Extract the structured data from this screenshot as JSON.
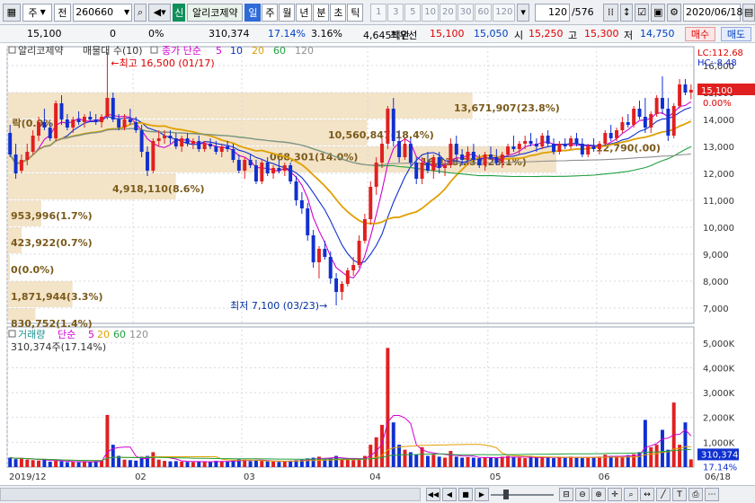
{
  "toolbar": {
    "market_type": "주",
    "market_scope": "전",
    "stock_code": "260660",
    "badge": "신",
    "stock_name": "알리코제약",
    "periods": [
      "일",
      "주",
      "월",
      "년",
      "분",
      "초",
      "틱"
    ],
    "selected_period": "일",
    "minute_units": [
      "1",
      "3",
      "5",
      "10",
      "20",
      "30",
      "60",
      "120"
    ],
    "count_display": "120",
    "count_total": "/576",
    "date": "2020/06/18"
  },
  "quote": {
    "price": "15,100",
    "change": "0",
    "change_pct": "0%",
    "volume": "310,374",
    "volume_ratio": "17.14%",
    "turnover": "3.16%",
    "amount": "4,645백만",
    "best_label": "최우선",
    "best_ask": "15,100",
    "best_bid": "15,050",
    "open_label": "시",
    "open": "15,250",
    "high_label": "고",
    "high": "15,300",
    "low_label": "저",
    "low": "14,750",
    "buy_label": "매수",
    "sell_label": "매도"
  },
  "legend": {
    "stock_name": "알리코제약",
    "profile_label": "매물대 수(10)",
    "ma_label": "종가 단순",
    "ma_periods": [
      "5",
      "10",
      "20",
      "60",
      "120"
    ],
    "ma_colors": [
      "#d000d0",
      "#1030d0",
      "#e0a000",
      "#20a040",
      "#909090"
    ],
    "lc": "LC:112.68",
    "hc": "HC:-8.48",
    "volume_label": "거래량",
    "volume_ma_label": "단순",
    "volume_info": "310,374주(17.14%)"
  },
  "colors": {
    "up": "#e02020",
    "down": "#1030d0",
    "profile": "#f3e3c7",
    "price_tag": "#e02020"
  },
  "chart_data": {
    "type": "candlestick",
    "price_axis": {
      "min": 6500,
      "max": 16500,
      "ticks": [
        7000,
        8000,
        9000,
        10000,
        11000,
        12000,
        13000,
        14000,
        15000,
        16000
      ],
      "labels": [
        "7,000",
        "8,000",
        "9,000",
        "10,000",
        "11,000",
        "12,000",
        "13,000",
        "14,000",
        "15,000",
        "16,000"
      ]
    },
    "current_price_label": "15,100",
    "current_price_pct": "0.00%",
    "volume_axis": {
      "max": 5500000,
      "ticks": [
        1000000,
        2000000,
        3000000,
        4000000,
        5000000
      ],
      "labels": [
        "1,000K",
        "2,000K",
        "3,000K",
        "4,000K",
        "5,000K"
      ]
    },
    "current_volume_label": "310,374",
    "current_volume_pct": "17.14%",
    "x_labels": [
      {
        "i": 0,
        "t": "2019/12"
      },
      {
        "i": 22,
        "t": "02"
      },
      {
        "i": 41,
        "t": "03"
      },
      {
        "i": 63,
        "t": "04"
      },
      {
        "i": 84,
        "t": "05"
      },
      {
        "i": 103,
        "t": "06"
      }
    ],
    "x_last_label": "06/18",
    "n_days": 120,
    "max_note": "최고 16,500 (01/17)",
    "min_note": "최저 7,100 (03/23)",
    "profile": [
      {
        "lo": 14000,
        "hi": 15000,
        "label": "13,671,907(23.8%)"
      },
      {
        "lo": 13000,
        "hi": 14000,
        "label": "10,560,847(18.4%)"
      },
      {
        "lo": 12000,
        "hi": 13000,
        "label": "16,138,232(28.1%)"
      },
      {
        "lo": 11000,
        "hi": 12000,
        "label": "4,918,110(8.6%)"
      },
      {
        "lo": 10000,
        "hi": 11000,
        "label": "953,996(1.7%)"
      },
      {
        "lo": 9000,
        "hi": 10000,
        "label": "423,922(0.7%)"
      },
      {
        "lo": 8000,
        "hi": 9000,
        "label": "0(0.0%)"
      },
      {
        "lo": 7000,
        "hi": 8000,
        "label": "1,871,944(3.3%)"
      },
      {
        "lo": 6000,
        "hi": 7000,
        "label": "830,752(1.4%)"
      }
    ],
    "extra_labels": [
      {
        "i": 1,
        "p": 13900,
        "t": "락(0.0%)"
      },
      {
        "i": 46,
        "p": 12650,
        "t": "068,301(14.0%)"
      },
      {
        "i": 103,
        "p": 12990,
        "t": "12,790(.00)"
      }
    ],
    "ohlc": [
      [
        13500,
        13800,
        12600,
        12700
      ],
      [
        12700,
        13100,
        11800,
        12000
      ],
      [
        12100,
        12700,
        12000,
        12500
      ],
      [
        12500,
        13100,
        12300,
        12800
      ],
      [
        12800,
        13600,
        12700,
        13400
      ],
      [
        13400,
        14100,
        13200,
        13900
      ],
      [
        13900,
        14400,
        13600,
        13700
      ],
      [
        13700,
        13900,
        13200,
        13300
      ],
      [
        13300,
        14700,
        13200,
        14600
      ],
      [
        14600,
        14900,
        13800,
        14000
      ],
      [
        14000,
        14200,
        13600,
        13700
      ],
      [
        13700,
        14100,
        13500,
        14000
      ],
      [
        14000,
        14300,
        13800,
        13900
      ],
      [
        13900,
        14200,
        13700,
        14100
      ],
      [
        14100,
        14300,
        13900,
        14000
      ],
      [
        14000,
        14200,
        13800,
        13900
      ],
      [
        13900,
        14200,
        13700,
        14100
      ],
      [
        14100,
        16500,
        14000,
        14800
      ],
      [
        14800,
        15000,
        13900,
        14000
      ],
      [
        14000,
        14200,
        13600,
        13700
      ],
      [
        13700,
        14200,
        13600,
        14000
      ],
      [
        14000,
        14400,
        13800,
        13900
      ],
      [
        13900,
        14100,
        13500,
        13600
      ],
      [
        13600,
        13800,
        12600,
        12800
      ],
      [
        12800,
        13000,
        11900,
        12100
      ],
      [
        12100,
        13300,
        12000,
        13200
      ],
      [
        13200,
        13600,
        13000,
        13300
      ],
      [
        13300,
        13600,
        13100,
        13400
      ],
      [
        13400,
        13600,
        13100,
        13300
      ],
      [
        13300,
        13500,
        12900,
        13000
      ],
      [
        13000,
        13400,
        12800,
        13300
      ],
      [
        13300,
        13500,
        13000,
        13100
      ],
      [
        13100,
        13300,
        12900,
        13200
      ],
      [
        13200,
        13400,
        12800,
        12900
      ],
      [
        12900,
        13200,
        12800,
        13100
      ],
      [
        13100,
        13300,
        12900,
        13000
      ],
      [
        13000,
        13200,
        12700,
        12800
      ],
      [
        12800,
        13100,
        12600,
        13000
      ],
      [
        13000,
        13200,
        12800,
        12900
      ],
      [
        12900,
        13100,
        12400,
        12500
      ],
      [
        12500,
        12700,
        12000,
        12100
      ],
      [
        12100,
        12600,
        11800,
        12500
      ],
      [
        12500,
        12700,
        12200,
        12300
      ],
      [
        12300,
        12500,
        11600,
        11700
      ],
      [
        11700,
        12500,
        11600,
        12400
      ],
      [
        12400,
        12600,
        11900,
        12000
      ],
      [
        12000,
        12300,
        11800,
        12200
      ],
      [
        12200,
        12500,
        12000,
        12100
      ],
      [
        12100,
        12400,
        11900,
        12300
      ],
      [
        12300,
        12400,
        11600,
        11700
      ],
      [
        11700,
        11900,
        10800,
        11000
      ],
      [
        11000,
        11300,
        10500,
        10700
      ],
      [
        10700,
        10900,
        9500,
        9700
      ],
      [
        9700,
        9900,
        8500,
        8700
      ],
      [
        8700,
        9300,
        8100,
        9200
      ],
      [
        9200,
        9500,
        8800,
        8900
      ],
      [
        8900,
        9100,
        7900,
        8100
      ],
      [
        8100,
        8300,
        7100,
        7600
      ],
      [
        7600,
        8000,
        7300,
        7900
      ],
      [
        7900,
        8500,
        7800,
        8400
      ],
      [
        8400,
        8900,
        8200,
        8600
      ],
      [
        8600,
        9700,
        8500,
        9500
      ],
      [
        9500,
        10500,
        9400,
        10300
      ],
      [
        10300,
        11700,
        10100,
        11500
      ],
      [
        11500,
        12600,
        11200,
        12400
      ],
      [
        12400,
        13300,
        12200,
        13100
      ],
      [
        13100,
        14500,
        12900,
        14400
      ],
      [
        14400,
        14800,
        13000,
        13200
      ],
      [
        13200,
        13600,
        12400,
        12600
      ],
      [
        12600,
        13300,
        12500,
        13100
      ],
      [
        13100,
        13300,
        12300,
        12400
      ],
      [
        12400,
        12600,
        11600,
        11800
      ],
      [
        11800,
        12600,
        11600,
        12400
      ],
      [
        12400,
        12800,
        12000,
        12100
      ],
      [
        12100,
        12700,
        11800,
        12600
      ],
      [
        12600,
        12800,
        12000,
        12200
      ],
      [
        12200,
        12500,
        11900,
        12300
      ],
      [
        12300,
        13300,
        12200,
        13100
      ],
      [
        13100,
        13400,
        12600,
        12700
      ],
      [
        12700,
        12900,
        12300,
        12500
      ],
      [
        12500,
        13000,
        12300,
        12800
      ],
      [
        12800,
        13100,
        12400,
        12500
      ],
      [
        12500,
        12700,
        12200,
        12300
      ],
      [
        12300,
        12800,
        12100,
        12700
      ],
      [
        12700,
        13000,
        12500,
        12600
      ],
      [
        12600,
        12900,
        12300,
        12400
      ],
      [
        12400,
        12800,
        12200,
        12700
      ],
      [
        12700,
        13100,
        12600,
        13000
      ],
      [
        13000,
        13400,
        12800,
        12900
      ],
      [
        12900,
        13200,
        12700,
        13100
      ],
      [
        13100,
        13400,
        12900,
        13200
      ],
      [
        13200,
        13500,
        13000,
        13100
      ],
      [
        13100,
        13300,
        12800,
        13000
      ],
      [
        13000,
        13500,
        12900,
        13400
      ],
      [
        13400,
        13600,
        13000,
        13100
      ],
      [
        13100,
        13300,
        12700,
        12800
      ],
      [
        12800,
        13200,
        12700,
        13100
      ],
      [
        13100,
        13300,
        12900,
        13000
      ],
      [
        13000,
        13400,
        12900,
        13300
      ],
      [
        13300,
        13500,
        13000,
        13100
      ],
      [
        13100,
        13300,
        12600,
        12700
      ],
      [
        12700,
        13100,
        12600,
        13000
      ],
      [
        13000,
        13300,
        12800,
        12900
      ],
      [
        12900,
        13200,
        12700,
        13100
      ],
      [
        13100,
        13600,
        13000,
        13500
      ],
      [
        13500,
        13800,
        13200,
        13300
      ],
      [
        13300,
        13700,
        13200,
        13600
      ],
      [
        13600,
        14100,
        13500,
        13900
      ],
      [
        13900,
        14200,
        13700,
        13800
      ],
      [
        13800,
        14500,
        13700,
        14400
      ],
      [
        14400,
        14700,
        14000,
        14100
      ],
      [
        14100,
        14800,
        13500,
        13700
      ],
      [
        13700,
        14300,
        13500,
        14200
      ],
      [
        14200,
        14900,
        14100,
        14800
      ],
      [
        14800,
        15600,
        14200,
        14400
      ],
      [
        14400,
        14800,
        13200,
        13400
      ],
      [
        13400,
        14600,
        13300,
        14500
      ],
      [
        14500,
        15500,
        14400,
        15300
      ],
      [
        15300,
        15500,
        14900,
        15000
      ],
      [
        15000,
        15300,
        14750,
        15100
      ]
    ],
    "volume": [
      380000,
      320000,
      360000,
      300000,
      280000,
      260000,
      300000,
      220000,
      250000,
      230000,
      200000,
      210000,
      190000,
      230000,
      200000,
      240000,
      260000,
      2100000,
      900000,
      450000,
      300000,
      280000,
      260000,
      420000,
      450000,
      600000,
      300000,
      250000,
      230000,
      240000,
      220000,
      210000,
      200000,
      230000,
      220000,
      210000,
      250000,
      230000,
      220000,
      260000,
      320000,
      300000,
      240000,
      280000,
      260000,
      230000,
      220000,
      210000,
      240000,
      260000,
      280000,
      300000,
      350000,
      380000,
      420000,
      300000,
      380000,
      450000,
      300000,
      320000,
      280000,
      350000,
      450000,
      900000,
      1200000,
      1700000,
      4800000,
      1800000,
      900000,
      700000,
      600000,
      500000,
      800000,
      450000,
      500000,
      420000,
      380000,
      650000,
      420000,
      380000,
      400000,
      380000,
      360000,
      400000,
      380000,
      360000,
      420000,
      450000,
      400000,
      380000,
      360000,
      400000,
      380000,
      420000,
      380000,
      360000,
      380000,
      400000,
      420000,
      380000,
      360000,
      380000,
      400000,
      420000,
      500000,
      450000,
      400000,
      420000,
      480000,
      520000,
      600000,
      1900000,
      800000,
      900000,
      1500000,
      700000,
      2600000,
      900000,
      1800000,
      310374
    ]
  },
  "bottom": {
    "nav_prev_fast": "◀◀",
    "nav_prev": "◀",
    "nav_stop": "■",
    "nav_next": "▶"
  }
}
